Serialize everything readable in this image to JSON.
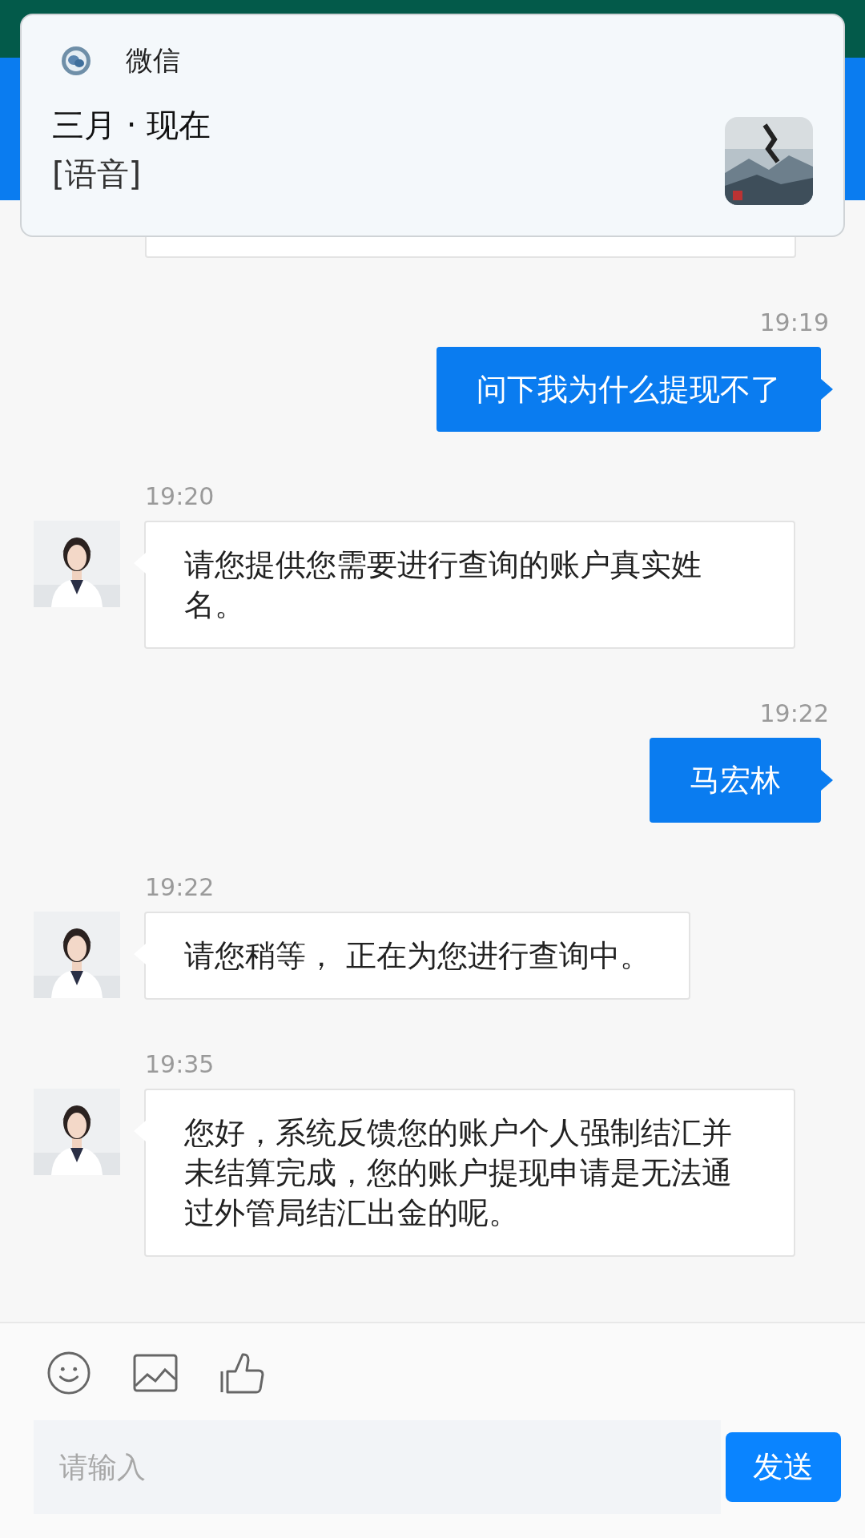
{
  "notification": {
    "app": "微信",
    "title": "三月 · 现在",
    "body": "[语音]"
  },
  "messages": [
    {
      "time": "19:19",
      "kind": "sent",
      "text": "问下我为什么提现不了"
    },
    {
      "time": "19:20",
      "kind": "received",
      "text": "请您提供您需要进行查询的账户真实姓名。"
    },
    {
      "time": "19:22",
      "kind": "sent",
      "text": "马宏林"
    },
    {
      "time": "19:22",
      "kind": "received",
      "text": "请您稍等， 正在为您进行查询中。"
    },
    {
      "time": "19:35",
      "kind": "received",
      "text": "您好，系统反馈您的账户个人强制结汇并未结算完成，您的账户提现申请是无法通过外管局结汇出金的呢。"
    }
  ],
  "composer": {
    "placeholder": "请输入",
    "send": "发送"
  }
}
